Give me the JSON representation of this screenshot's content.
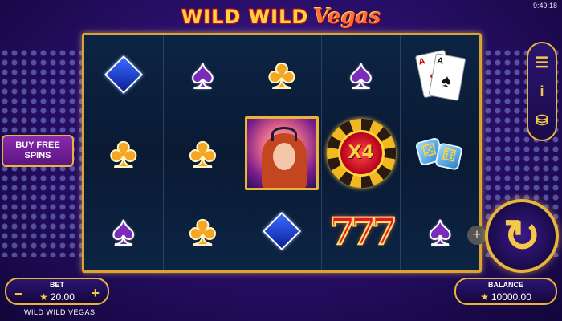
{
  "status": {
    "clock": "9:49:18"
  },
  "logo": {
    "part1": "WILD WILD",
    "part2": "Vegas"
  },
  "reels": [
    [
      "diamond",
      "club",
      "spade"
    ],
    [
      "spade",
      "club",
      "club"
    ],
    [
      "club",
      "portrait",
      "diamond"
    ],
    [
      "spade",
      "x4-chip",
      "triple-seven"
    ],
    [
      "playing-cards",
      "dice",
      "spade"
    ]
  ],
  "symbols": {
    "multiplier": "X4",
    "sevens": "777",
    "ace": "A",
    "ace_suit": "♠",
    "heart_card": "A",
    "heart_suit": "♥"
  },
  "menu": {
    "hamburger": "☰",
    "info": "i",
    "coins": "⛁"
  },
  "buy_free_spins": {
    "label": "BUY FREE SPINS"
  },
  "bet": {
    "label": "BET",
    "value": "20.00",
    "minus": "−",
    "plus": "+"
  },
  "balance": {
    "label": "BALANCE",
    "value": "10000.00"
  },
  "game_name": "WILD WILD VEGAS",
  "spin": {
    "icon": "↻"
  },
  "side_plus": "+",
  "colors": {
    "gold": "#e8b43a",
    "purple": "#7a2bb8",
    "club": "#f5a623",
    "diamond": "#3a6cff"
  }
}
